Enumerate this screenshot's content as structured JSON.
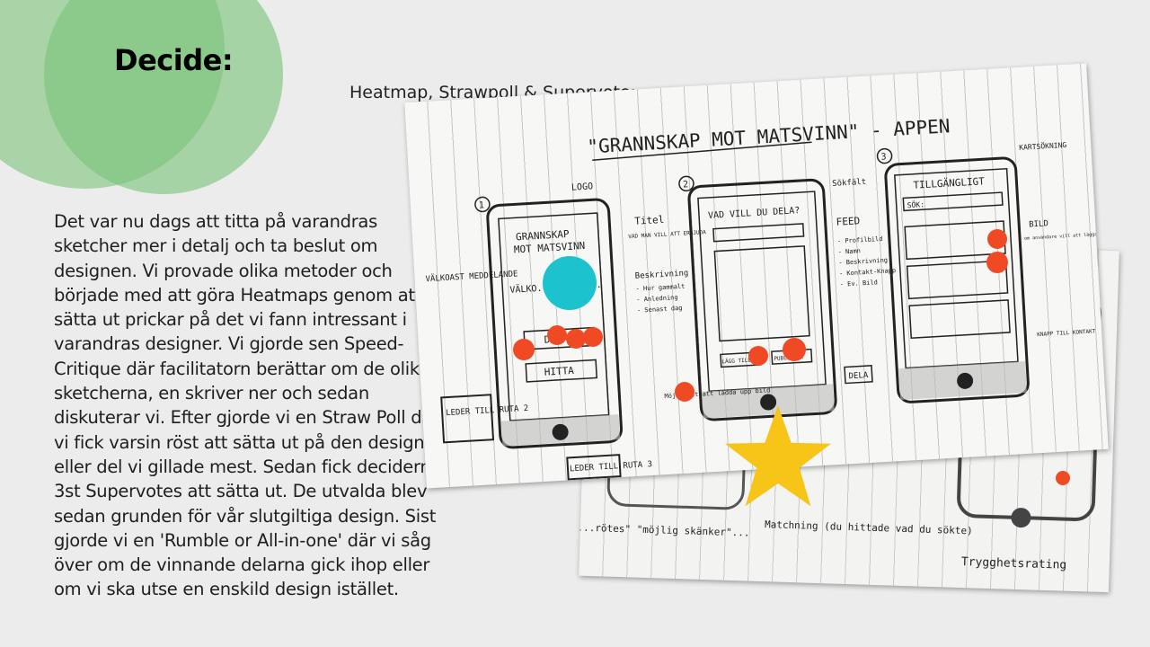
{
  "slide": {
    "title": "Decide:",
    "caption": "Heatmap, Strawpoll & Supervote:",
    "body": "Det var nu dags att titta på varandras sketcher mer i detalj och ta beslut om designen. Vi provade olika metoder och började med att göra Heatmaps genom att sätta ut prickar på det vi fann intressant i varandras designer. Vi gjorde sen Speed-Critique där facilitatorn berättar om de olika sketcherna, en skriver ner och sedan diskuterar vi. Efter gjorde vi en Straw Poll där vi fick varsin röst att sätta ut på den design eller del vi gillade mest. Sedan fick decidern 3st Supervotes att sätta ut. De utvalda blev sedan grunden för vår slutgiltiga design. Sist gjorde vi en 'Rumble or All-in-one' där vi såg över om de vinnande delarna gick ihop eller om vi ska utse en enskild design istället."
  },
  "sketch": {
    "heading": "\"GRANNSKAP MOT MATSVINN\" - APPEN",
    "logo_label": "LOGO",
    "welcome_label": "VÄLKOAST MEDDELANDE",
    "screen1_title_1": "GRANNSKAP",
    "screen1_title_2": "MOT MATSVINN",
    "screen1_welcome": "VÄLKO... VAD V...",
    "btn_share": "DELA",
    "btn_find": "HITTA",
    "note_screen2": "LEDER TILL RUTA 2",
    "note_screen3": "LEDER TILL RUTA 3",
    "screen2_title": "VAD VILL DU DELA?",
    "title_label": "Titel",
    "title_sub": "VAD MAN VILL ATT ERBJUDA",
    "desc_label": "Beskrivning",
    "desc_items": [
      "- Hur gammalt",
      "- Anledning",
      "- Senast dag"
    ],
    "upload_label": "Möjlighet att ladda upp bild",
    "btn_add": "LÄGG TILL BILD",
    "btn_publish": "PUBLICERA",
    "share_label": "DELA",
    "screen3_title": "TILLGÄNGLIGT",
    "search_placeholder": "SÖK:",
    "search_field_label": "Sökfält",
    "map_search_label": "KARTSÖKNING",
    "feed_label": "FEED",
    "feed_items": [
      "- Profilbild",
      "- Namn",
      "- Beskrivning",
      "- Kontakt-Knapp",
      "- Ev. Bild"
    ],
    "image_label": "BILD",
    "image_note": "om användare vill att lägga till",
    "contact_btn_label": "KNAPP TILL KONTAKT",
    "num_1": "1",
    "num_2": "2",
    "num_3": "3",
    "back_note_1": "\"...rötes\" \"möjlig skänker\"...",
    "back_note_2": "Matchning (du hittade vad du sökte)",
    "back_note_3": "Trygghetsrating"
  },
  "votes": {
    "heat_color": "#f04a25",
    "straw_color": "#1cc3cf",
    "star_color": "#f6c518"
  }
}
